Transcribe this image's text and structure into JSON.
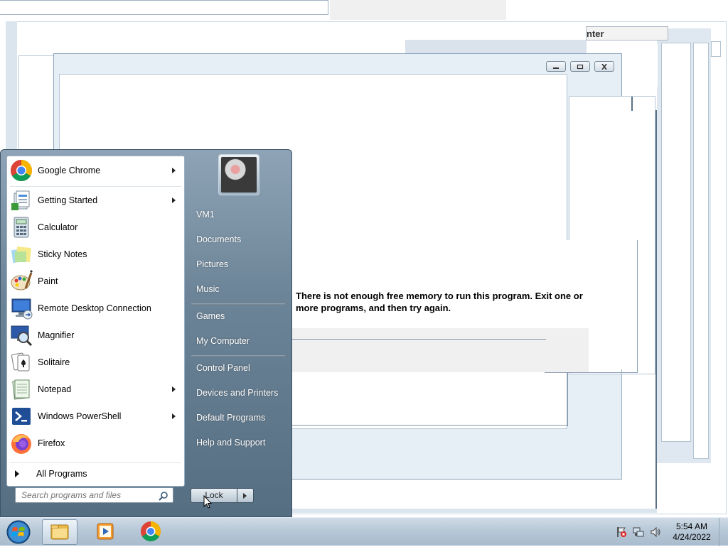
{
  "error_message": {
    "line1": "There is not enough free memory to run this program. Exit one or",
    "line2": "more programs, and then try again."
  },
  "background_window": {
    "peek_text": "nter",
    "caption_buttons": [
      "minimize",
      "restore",
      "close"
    ]
  },
  "start_menu": {
    "programs": [
      {
        "label": "Google Chrome",
        "icon": "chrome-icon",
        "submenu": true
      },
      {
        "label": "Getting Started",
        "icon": "getting-started-icon",
        "submenu": true
      },
      {
        "label": "Calculator",
        "icon": "calculator-icon",
        "submenu": false
      },
      {
        "label": "Sticky Notes",
        "icon": "sticky-notes-icon",
        "submenu": false
      },
      {
        "label": "Paint",
        "icon": "paint-icon",
        "submenu": false
      },
      {
        "label": "Remote Desktop Connection",
        "icon": "remote-desktop-icon",
        "submenu": false
      },
      {
        "label": "Magnifier",
        "icon": "magnifier-icon",
        "submenu": false
      },
      {
        "label": "Solitaire",
        "icon": "solitaire-icon",
        "submenu": false
      },
      {
        "label": "Notepad",
        "icon": "notepad-icon",
        "submenu": true
      },
      {
        "label": "Windows PowerShell",
        "icon": "powershell-icon",
        "submenu": true
      },
      {
        "label": "Firefox",
        "icon": "firefox-icon",
        "submenu": false
      }
    ],
    "all_programs": "All Programs",
    "search_placeholder": "Search programs and files",
    "right_links": [
      "VM1",
      "Documents",
      "Pictures",
      "Music",
      "Games",
      "My Computer",
      "Control Panel",
      "Devices and Printers",
      "Default Programs",
      "Help and Support"
    ],
    "shutdown_label": "Lock"
  },
  "taskbar": {
    "pinned": [
      "windows-explorer-icon",
      "media-player-icon",
      "chrome-icon"
    ],
    "clock_time": "5:54 AM",
    "clock_date": "4/24/2022",
    "tray_icons": [
      "action-center-flag-icon",
      "network-icon",
      "volume-icon"
    ]
  },
  "colors": {
    "start_menu_dark": "#566e82",
    "taskbar": "#b7c8d7",
    "window_frame": "#e6eef6"
  }
}
